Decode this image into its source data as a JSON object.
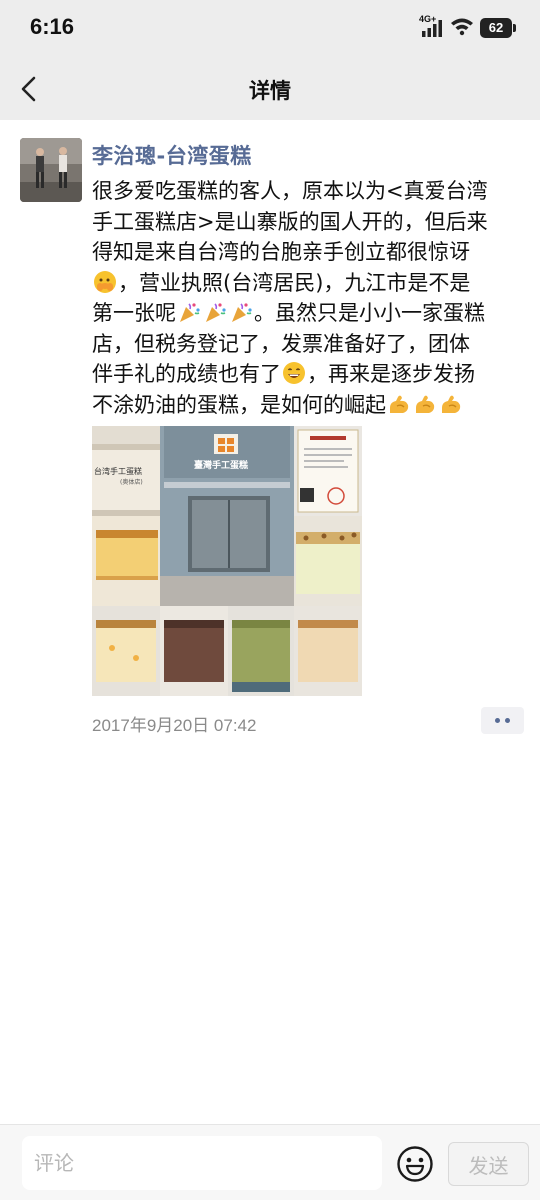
{
  "status_bar": {
    "time": "6:16",
    "network": "4G+",
    "battery": "62"
  },
  "nav": {
    "title": "详情"
  },
  "post": {
    "author": "李治璁-台湾蛋糕",
    "lines": [
      "很多爱吃蛋糕的客人，原本以为<真爱台湾",
      "手工蛋糕店>是山寨版的国人开的，但后来",
      "得知是来自台湾的台胞亲手创立都很惊讶",
      "，营业执照(台湾居民)，九江市是不是",
      "第一张呢",
      "。虽然只是小小一家蛋糕",
      "店，但税务登记了，发票准备好了，团体",
      "伴手礼的成绩也有了",
      "，再来是逐步发扬",
      "不涂奶油的蛋糕，是如何的崛起"
    ],
    "storefront_sign": "臺灣手工蛋糕",
    "box_label_line1": "台湾手工蛋糕",
    "box_label_line2": "(奥体店)",
    "time": "2017年9月20日 07:42"
  },
  "footer": {
    "comment_placeholder": "评论",
    "send_label": "发送"
  },
  "icons": {
    "back": "chevron-left-icon",
    "more": "more-dots-icon",
    "emoji": "smiley-face-icon",
    "emojis_in_text": [
      "peeking-face-icon",
      "party-popper-icon",
      "grinning-face-icon",
      "flexed-biceps-icon"
    ]
  },
  "colors": {
    "author": "#576b95",
    "header_bg": "#ededed",
    "time_text": "#8a8a8a"
  }
}
